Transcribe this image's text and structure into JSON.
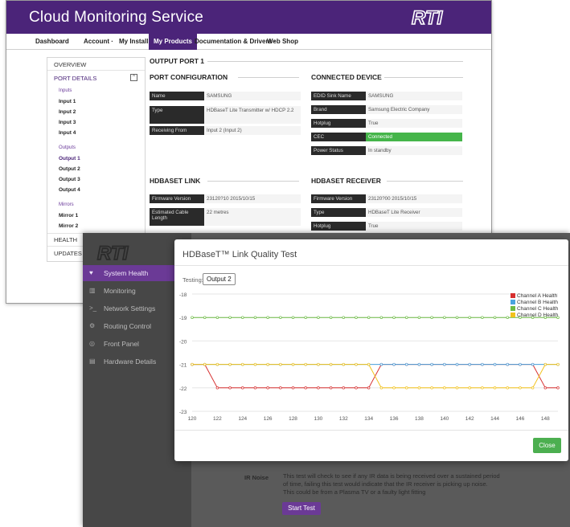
{
  "cloud": {
    "title": "Cloud Monitoring Service",
    "logo": "RTI",
    "nav": [
      {
        "label": "Dashboard"
      },
      {
        "label": "Account ·"
      },
      {
        "label": "My Installs"
      },
      {
        "label": "My Products"
      },
      {
        "label": "Documentation & Drivers ·"
      },
      {
        "label": "Web Shop"
      }
    ],
    "sidebar": {
      "overview": "OVERVIEW",
      "port_details": "PORT DETAILS",
      "collapse_icon": "^",
      "inputs_label": "Inputs",
      "inputs": [
        "Input 1",
        "Input 2",
        "Input 3",
        "Input 4"
      ],
      "outputs_label": "Outputs",
      "outputs": [
        "Output 1",
        "Output 2",
        "Output 3",
        "Output 4"
      ],
      "mirrors_label": "Mirrors",
      "mirrors": [
        "Mirror 1",
        "Mirror 2"
      ],
      "health": "HEALTH",
      "updates": "UPDATES"
    },
    "main": {
      "output_port": "OUTPUT PORT 1",
      "port_config": {
        "title": "PORT CONFIGURATION",
        "rows": [
          {
            "k": "Name",
            "v": "SAMSUNG"
          },
          {
            "k": "Type",
            "v": "HDBaseT Lite Transmitter w/ HDCP 2.2"
          },
          {
            "k": "Receiving From",
            "v": "Input 2 (Input 2)"
          }
        ]
      },
      "connected_device": {
        "title": "CONNECTED DEVICE",
        "rows": [
          {
            "k": "EDID Sink Name",
            "v": "SAMSUNG"
          },
          {
            "k": "Brand",
            "v": "Samsung Electric Company"
          },
          {
            "k": "Hotplug",
            "v": "True"
          },
          {
            "k": "CEC",
            "v": "Connected"
          },
          {
            "k": "Power Status",
            "v": "In standby"
          }
        ]
      },
      "hdbaset_link": {
        "title": "HDBASET LINK",
        "rows": [
          {
            "k": "Firmware Version",
            "v": "23120?10 2015/10/15"
          },
          {
            "k": "Estimated Cable Length",
            "v": "22 metres"
          }
        ]
      },
      "hdbaset_receiver": {
        "title": "HDBASET RECEIVER",
        "rows": [
          {
            "k": "Firmware Version",
            "v": "23120?00 2015/10/15"
          },
          {
            "k": "Type",
            "v": "HDBaseT Lite Receiver"
          },
          {
            "k": "Hotplug",
            "v": "True"
          }
        ]
      }
    }
  },
  "app": {
    "logo": "RTI",
    "nav": [
      {
        "label": "System Health",
        "icon": "heart-icon",
        "glyph": "♥"
      },
      {
        "label": "Monitoring",
        "icon": "chart-icon",
        "glyph": "▥"
      },
      {
        "label": "Network Settings",
        "icon": "terminal-icon",
        "glyph": ">_"
      },
      {
        "label": "Routing Control",
        "icon": "routing-icon",
        "glyph": "⚙"
      },
      {
        "label": "Front Panel",
        "icon": "front-panel-icon",
        "glyph": "◎"
      },
      {
        "label": "Hardware Details",
        "icon": "hardware-icon",
        "glyph": "▤"
      }
    ],
    "ir_noise_label": "IR Noise",
    "ir_noise_text": "This test will check to see if any IR data is being received over a sustained period of time, failing this test would indicate that the IR receiver is picking up noise. This could be from a Plasma TV or a faulty light fitting",
    "start_test": "Start Test"
  },
  "modal": {
    "title": "HDBaseT™ Link Quality Test",
    "testing_label": "Testing:",
    "testing_value": "Output 2",
    "close": "Close"
  },
  "chart_data": {
    "type": "line",
    "title": "",
    "xlabel": "",
    "ylabel": "",
    "xlim": [
      120,
      149
    ],
    "ylim": [
      -23,
      -18
    ],
    "x_ticks": [
      120,
      122,
      124,
      126,
      128,
      130,
      132,
      134,
      136,
      138,
      140,
      142,
      144,
      146,
      148
    ],
    "y_ticks": [
      -18,
      -19,
      -20,
      -21,
      -22,
      -23
    ],
    "grid": "horizontal",
    "legend": "top-right",
    "x": [
      120,
      121,
      122,
      123,
      124,
      125,
      126,
      127,
      128,
      129,
      130,
      131,
      132,
      133,
      134,
      135,
      136,
      137,
      138,
      139,
      140,
      141,
      142,
      143,
      144,
      145,
      146,
      147,
      148,
      149
    ],
    "series": [
      {
        "name": "Channel A Health",
        "color": "#d62f2f",
        "values": [
          -21,
          -21,
          -22,
          -22,
          -22,
          -22,
          -22,
          -22,
          -22,
          -22,
          -22,
          -22,
          -22,
          -22,
          -22,
          -21,
          -21,
          -21,
          -21,
          -21,
          -21,
          -21,
          -21,
          -21,
          -21,
          -21,
          -21,
          -21,
          -22,
          -22
        ]
      },
      {
        "name": "Channel B Health",
        "color": "#4aa3df",
        "values": [
          -21,
          -21,
          -21,
          -21,
          -21,
          -21,
          -21,
          -21,
          -21,
          -21,
          -21,
          -21,
          -21,
          -21,
          -21,
          -21,
          -21,
          -21,
          -21,
          -21,
          -21,
          -21,
          -21,
          -21,
          -21,
          -21,
          -21,
          -21,
          -21,
          -21
        ]
      },
      {
        "name": "Channel C Health",
        "color": "#6dbb45",
        "values": [
          -19,
          -19,
          -19,
          -19,
          -19,
          -19,
          -19,
          -19,
          -19,
          -19,
          -19,
          -19,
          -19,
          -19,
          -19,
          -19,
          -19,
          -19,
          -19,
          -19,
          -19,
          -19,
          -19,
          -19,
          -19,
          -19,
          -19,
          -19,
          -19,
          -19
        ]
      },
      {
        "name": "Channel D Health",
        "color": "#f2c21b",
        "values": [
          -21,
          -21,
          -21,
          -21,
          -21,
          -21,
          -21,
          -21,
          -21,
          -21,
          -21,
          -21,
          -21,
          -21,
          -21,
          -22,
          -22,
          -22,
          -22,
          -22,
          -22,
          -22,
          -22,
          -22,
          -22,
          -22,
          -22,
          -22,
          -21,
          -21
        ]
      }
    ]
  }
}
